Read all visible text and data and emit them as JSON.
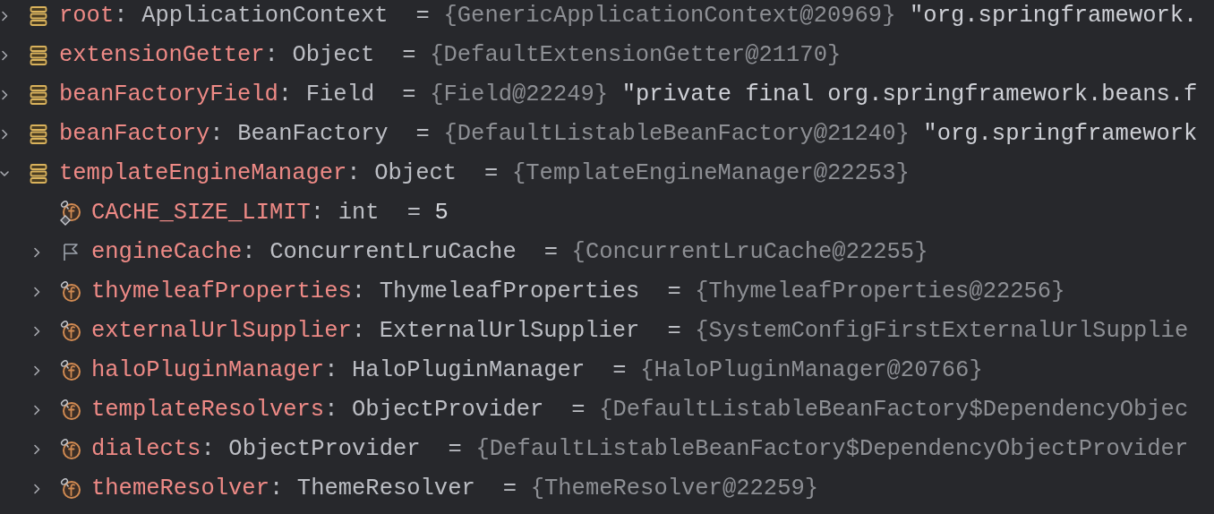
{
  "variables": [
    {
      "name": "root",
      "colon": ":",
      "type": "ApplicationContext",
      "equals": "=",
      "value": "{GenericApplicationContext@20969}",
      "detail": "\"org.springframework.",
      "kind": "bean",
      "primitive": false,
      "expanded": false
    },
    {
      "name": "extensionGetter",
      "colon": ":",
      "type": "Object",
      "equals": "=",
      "value": "{DefaultExtensionGetter@21170}",
      "kind": "bean",
      "primitive": false,
      "expanded": false
    },
    {
      "name": "beanFactoryField",
      "colon": ":",
      "type": "Field",
      "equals": "=",
      "value": "{Field@22249}",
      "detail": "\"private final org.springframework.beans.f",
      "kind": "bean",
      "primitive": false,
      "expanded": false
    },
    {
      "name": "beanFactory",
      "colon": ":",
      "type": "BeanFactory",
      "equals": "=",
      "value": "{DefaultListableBeanFactory@21240}",
      "detail": "\"org.springframework",
      "kind": "bean",
      "primitive": false,
      "expanded": false
    },
    {
      "name": "templateEngineManager",
      "colon": ":",
      "type": "Object",
      "equals": "=",
      "value": "{TemplateEngineManager@22253}",
      "kind": "bean",
      "primitive": false,
      "expanded": true,
      "children": [
        {
          "name": "CACHE_SIZE_LIMIT",
          "colon": ":",
          "type": "int",
          "equals": "=",
          "value": "5",
          "kind": "static_field",
          "primitive": true
        },
        {
          "name": "engineCache",
          "colon": ":",
          "type": "ConcurrentLruCache",
          "equals": "=",
          "value": "{ConcurrentLruCache@22255}",
          "kind": "flag",
          "primitive": false,
          "expanded": false
        },
        {
          "name": "thymeleafProperties",
          "colon": ":",
          "type": "ThymeleafProperties",
          "equals": "=",
          "value": "{ThymeleafProperties@22256}",
          "kind": "field",
          "primitive": false,
          "expanded": false
        },
        {
          "name": "externalUrlSupplier",
          "colon": ":",
          "type": "ExternalUrlSupplier",
          "equals": "=",
          "value": "{SystemConfigFirstExternalUrlSupplie",
          "kind": "field",
          "primitive": false,
          "expanded": false
        },
        {
          "name": "haloPluginManager",
          "colon": ":",
          "type": "HaloPluginManager",
          "equals": "=",
          "value": "{HaloPluginManager@20766}",
          "kind": "field",
          "primitive": false,
          "expanded": false
        },
        {
          "name": "templateResolvers",
          "colon": ":",
          "type": "ObjectProvider",
          "equals": "=",
          "value": "{DefaultListableBeanFactory$DependencyObjec",
          "kind": "field",
          "primitive": false,
          "expanded": false
        },
        {
          "name": "dialects",
          "colon": ":",
          "type": "ObjectProvider",
          "equals": "=",
          "value": "{DefaultListableBeanFactory$DependencyObjectProvider",
          "kind": "field",
          "primitive": false,
          "expanded": false
        },
        {
          "name": "themeResolver",
          "colon": ":",
          "type": "ThemeResolver",
          "equals": "=",
          "value": "{ThemeResolver@22259}",
          "kind": "field",
          "primitive": false,
          "expanded": false
        }
      ]
    }
  ]
}
